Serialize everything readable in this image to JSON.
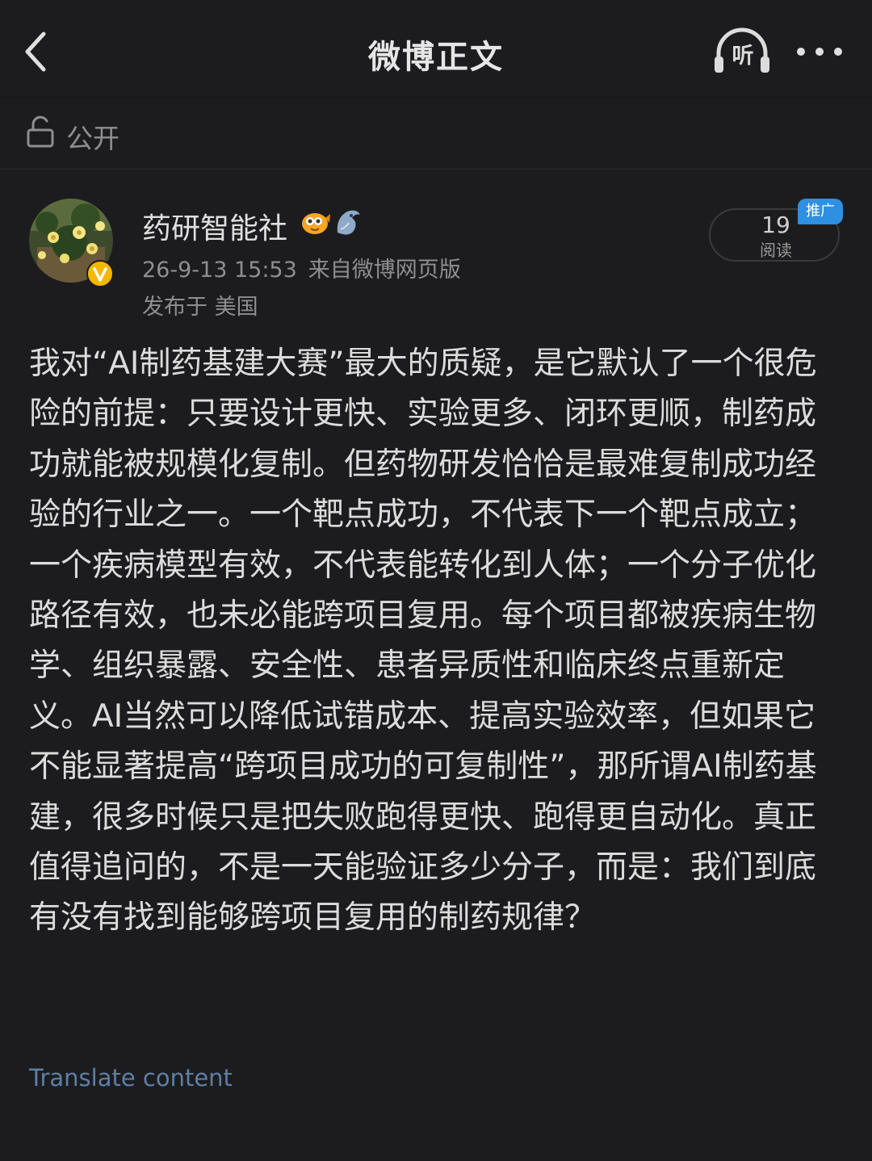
{
  "header": {
    "title": "微博正文",
    "listen_label": "听"
  },
  "visibility": {
    "label": "公开"
  },
  "author": {
    "name": "药研智能社",
    "verified": true
  },
  "post": {
    "timestamp": "26-9-13 15:53",
    "source": "来自微博网页版",
    "location": "发布于 美国",
    "read_count": "19",
    "read_label": "阅读",
    "promo_label": "推广",
    "content": "我对“AI制药基建大赛”最大的质疑，是它默认了一个很危险的前提：只要设计更快、实验更多、闭环更顺，制药成功就能被规模化复制。但药物研发恰恰是最难复制成功经验的行业之一。一个靶点成功，不代表下一个靶点成立；一个疾病模型有效，不代表能转化到人体；一个分子优化路径有效，也未必能跨项目复用。每个项目都被疾病生物学、组织暴露、安全性、患者异质性和临床终点重新定义。AI当然可以降低试错成本、提高实验效率，但如果它不能显著提高“跨项目成功的可复制性”，那所谓AI制药基建，很多时候只是把失败跑得更快、跑得更自动化。真正值得追问的，不是一天能验证多少分子，而是：我们到底有没有找到能够跨项目复用的制药规律？",
    "translate_label": "Translate content"
  },
  "colors": {
    "background": "#1c1c1e",
    "primary_text": "#dcdcdc",
    "secondary_text": "#8e8e93",
    "link": "#5d7fa6",
    "promo": "#2f8fe0",
    "verified": "#f5b800"
  }
}
